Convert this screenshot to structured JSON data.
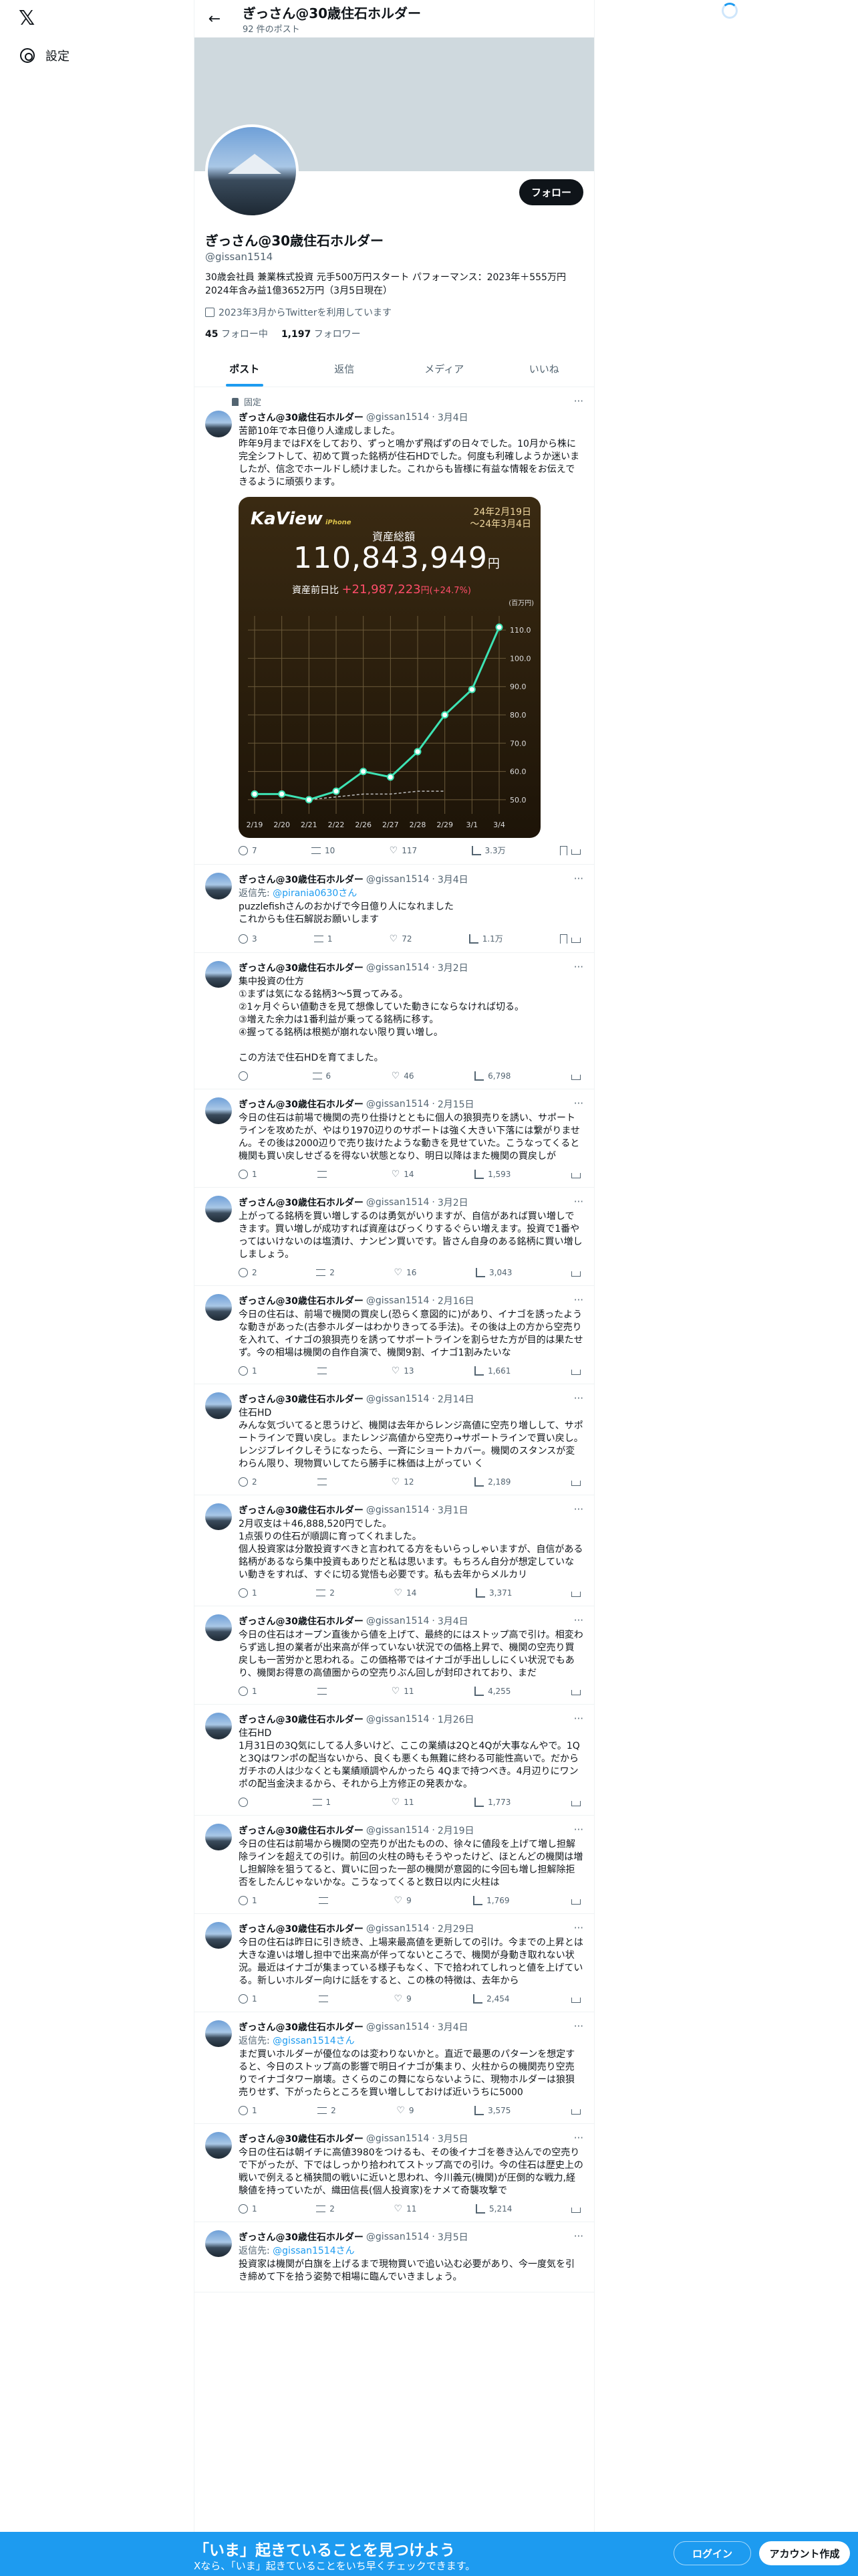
{
  "nav": {
    "logo": "𝕏",
    "settings": "設定"
  },
  "header": {
    "title": "ぎっさん@30歳住石ホルダー",
    "subtitle": "92 件のポスト",
    "back": "←"
  },
  "profile": {
    "name": "ぎっさん@30歳住石ホルダー",
    "handle": "@gissan1514",
    "follow": "フォロー",
    "bio": "30歳会社員 兼業株式投資 元手500万円スタート パフォーマンス：2023年＋555万円\n2024年含み益1億3652万円（3月5日現在）",
    "joined": "2023年3月からTwitterを利用しています",
    "following_count": "45",
    "following_label": "フォロー中",
    "followers_count": "1,197",
    "followers_label": "フォロワー"
  },
  "tabs": [
    "ポスト",
    "返信",
    "メディア",
    "いいね"
  ],
  "pinned_label": "固定",
  "tweets": [
    {
      "name": "ぎっさん@30歳住石ホルダー",
      "handle": "@gissan1514",
      "date": "3月4日",
      "text": "苦節10年で本日億り人達成しました。\n昨年9月まではFXをしており、ずっと鳴かず飛ばずの日々でした。10月から株に完全シフトして、初めて買った銘柄が住石HDでした。何度も利確しようか迷いましたが、信念でホールドし続けました。これからも皆様に有益な情報をお伝えできるように頑張ります。",
      "reply": "7",
      "rt": "10",
      "like": "117",
      "views": "3.3万"
    },
    {
      "name": "ぎっさん@30歳住石ホルダー",
      "handle": "@gissan1514",
      "date": "3月4日",
      "reply_to": "返信先: ",
      "reply_handle": "@pirania0630さん",
      "text": "puzzlefishさんのおかげで今日億り人になれました\nこれからも住石解説お願いします",
      "reply": "3",
      "rt": "1",
      "like": "72",
      "views": "1.1万"
    },
    {
      "name": "ぎっさん@30歳住石ホルダー",
      "handle": "@gissan1514",
      "date": "3月2日",
      "text": "集中投資の仕方\n①まずは気になる銘柄3〜5買ってみる。\n②1ヶ月ぐらい値動きを見て想像していた動きにならなければ切る。\n③増えた余力は1番利益が乗ってる銘柄に移す。\n④握ってる銘柄は根拠が崩れない限り買い増し。\n\nこの方法で住石HDを育てました。",
      "reply": "",
      "rt": "6",
      "like": "46",
      "views": "6,798"
    },
    {
      "name": "ぎっさん@30歳住石ホルダー",
      "handle": "@gissan1514",
      "date": "2月15日",
      "text": "今日の住石は前場で機関の売り仕掛けとともに個人の狼狽売りを誘い、サポートラインを攻めたが、やはり1970辺りのサポートは強く大きい下落には繋がりません。その後は2000辺りで売り抜けたような動きを見せていた。こうなってくると機関も買い戻しせざるを得ない状態となり、明日以降はまた機関の買戻しが",
      "reply": "1",
      "rt": "",
      "like": "14",
      "views": "1,593"
    },
    {
      "name": "ぎっさん@30歳住石ホルダー",
      "handle": "@gissan1514",
      "date": "3月2日",
      "text": "上がってる銘柄を買い増しするのは勇気がいりますが、自信があれば買い増しできます。買い増しが成功すれば資産はびっくりするぐらい増えます。投資で1番やってはいけないのは塩漬け、ナンピン買いです。皆さん自身のある銘柄に買い増ししましょう。",
      "reply": "2",
      "rt": "2",
      "like": "16",
      "views": "3,043"
    },
    {
      "name": "ぎっさん@30歳住石ホルダー",
      "handle": "@gissan1514",
      "date": "2月16日",
      "text": "今日の住石は、前場で機関の買戻し(恐らく意図的に)があり、イナゴを誘ったような動きがあった(古参ホルダーはわかりきってる手法)。その後は上の方から空売りを入れて、イナゴの狼狽売りを誘ってサポートラインを割らせた方が目的は果たせず。今の相場は機関の自作自演で、機関9割、イナゴ1割みたいな",
      "reply": "1",
      "rt": "",
      "like": "13",
      "views": "1,661"
    },
    {
      "name": "ぎっさん@30歳住石ホルダー",
      "handle": "@gissan1514",
      "date": "2月14日",
      "text": "住石HD\nみんな気づいてると思うけど、機関は去年からレンジ高値に空売り増しして、サポートラインで買い戻し。またレンジ高値から空売り→サポートラインで買い戻し。レンジブレイクしそうになったら、一斉にショートカバー。機関のスタンスが変わらん限り、現物買いしてたら勝手に株価は上がってい く",
      "reply": "2",
      "rt": "",
      "like": "12",
      "views": "2,189"
    },
    {
      "name": "ぎっさん@30歳住石ホルダー",
      "handle": "@gissan1514",
      "date": "3月1日",
      "text": "2月収支は＋46,888,520円でした。\n1点張りの住石が順調に育ってくれました。\n個人投資家は分散投資すべきと言われてる方をもいらっしゃいますが、自信がある銘柄があるなら集中投資もありだと私は思います。もちろん自分が想定していない動きをすれば、すぐに切る覚悟も必要です。私も去年からメルカリ",
      "reply": "1",
      "rt": "2",
      "like": "14",
      "views": "3,371"
    },
    {
      "name": "ぎっさん@30歳住石ホルダー",
      "handle": "@gissan1514",
      "date": "3月4日",
      "text": "今日の住石はオープン直後から値を上げて、最終的にはストップ高で引け。相変わらず逃し担の業者が出来高が伴っていない状況での価格上昇で、機関の空売り買戻しも一苦労かと思われる。この価格帯ではイナゴが手出ししにくい状況でもあり、機関お得意の高値圏からの空売りぶん回しが封印されており、まだ",
      "reply": "1",
      "rt": "",
      "like": "11",
      "views": "4,255"
    },
    {
      "name": "ぎっさん@30歳住石ホルダー",
      "handle": "@gissan1514",
      "date": "1月26日",
      "text": "住石HD\n1月31日の3Q気にしてる人多いけど、ここの業績は2Qと4Qが大事なんやで。1Qと3Qはワンポの配当ないから、良くも悪くも無難に終わる可能性高いで。だからガチホの人は少なくとも業績順調やんかったら 4Qまで持つべき。4月辺りにワンポの配当金決まるから、それから上方修正の発表かな。",
      "reply": "",
      "rt": "1",
      "like": "11",
      "views": "1,773"
    },
    {
      "name": "ぎっさん@30歳住石ホルダー",
      "handle": "@gissan1514",
      "date": "2月19日",
      "text": "今日の住石は前場から機関の空売りが出たものの、徐々に値段を上げて増し担解除ラインを超えての引け。前回の火柱の時もそうやったけど、ほとんどの機関は増し担解除を狙うてると、買いに回った一部の機関が意図的に今回も増し担解除拒否をしたんじゃないかな。こうなってくると数日以内に火柱は",
      "reply": "1",
      "rt": "",
      "like": "9",
      "views": "1,769"
    },
    {
      "name": "ぎっさん@30歳住石ホルダー",
      "handle": "@gissan1514",
      "date": "2月29日",
      "text": "今日の住石は昨日に引き続き、上場来最高値を更新しての引け。今までの上昇とは大きな違いは増し担中で出来高が伴ってないところで、機関が身動き取れない状況。最近はイナゴが集まっている様子もなく、下で拾われてしれっと値を上げている。新しいホルダー向けに話をすると、この株の特徴は、去年から",
      "reply": "1",
      "rt": "",
      "like": "9",
      "views": "2,454"
    },
    {
      "name": "ぎっさん@30歳住石ホルダー",
      "handle": "@gissan1514",
      "date": "3月4日",
      "reply_to": "返信先: ",
      "reply_handle": "@gissan1514さん",
      "text": "まだ買いホルダーが優位なのは変わりないかと。直近で最悪のパターンを想定すると、今日のストップ高の影響で明日イナゴが集まり、火柱からの機関売り空売りでイナゴタワー崩壊。さくらのこの舞にならないように、現物ホルダーは狼狽売りせず、下がったらところを買い増ししておけば近いうちに5000",
      "reply": "1",
      "rt": "2",
      "like": "9",
      "views": "3,575"
    },
    {
      "name": "ぎっさん@30歳住石ホルダー",
      "handle": "@gissan1514",
      "date": "3月5日",
      "text": "今日の住石は朝イチに高値3980をつけるも、その後イナゴを巻き込んでの空売りで下がったが、下ではしっかり拾われてストップ高での引け。今の住石は歴史上の戦いで例えると桶狭間の戦いに近いと思われ、今川義元(機関)が圧倒的な戦力,経験値を持っていたが、織田信長(個人投資家)をナメて奇襲攻撃で",
      "reply": "1",
      "rt": "2",
      "like": "11",
      "views": "5,214"
    },
    {
      "name": "ぎっさん@30歳住石ホルダー",
      "handle": "@gissan1514",
      "date": "3月5日",
      "reply_to": "返信先: ",
      "reply_handle": "@gissan1514さん",
      "text": "投資家は機関が白旗を上げるまで現物買いで追い込む必要があり、今一度気を引き締めて下を拾う姿勢で相場に臨んでいきましょう。"
    }
  ],
  "chart_data": {
    "type": "line",
    "brand": "KaView",
    "brand_sub": "iPhone",
    "title": "資産総額",
    "date_range": [
      "24年2月19日",
      "〜24年3月4日"
    ],
    "total": "110,843,949",
    "total_unit": "円",
    "diff_label": "資産前日比",
    "diff_value": "+21,987,223",
    "diff_unit": "円",
    "diff_pct": "(+24.7%)",
    "unit_label": "(百万円)",
    "categories": [
      "2/19",
      "2/20",
      "2/21",
      "2/22",
      "2/26",
      "2/27",
      "2/28",
      "2/29",
      "3/1",
      "3/4"
    ],
    "values": [
      52,
      52,
      50,
      53,
      60,
      58,
      67,
      80,
      89,
      111
    ],
    "baseline": [
      52,
      52,
      50,
      51,
      52,
      52,
      53,
      53,
      null,
      null
    ],
    "ylim": [
      45,
      115
    ],
    "yticks": [
      50,
      60,
      70,
      80,
      90,
      100,
      110
    ],
    "line_color": "#3de3b4"
  },
  "footer": {
    "title": "「いま」起きていることを見つけよう",
    "subtitle": "Xなら、「いま」起きていることをいち早くチェックできます。",
    "login": "ログイン",
    "signup": "アカウント作成"
  }
}
